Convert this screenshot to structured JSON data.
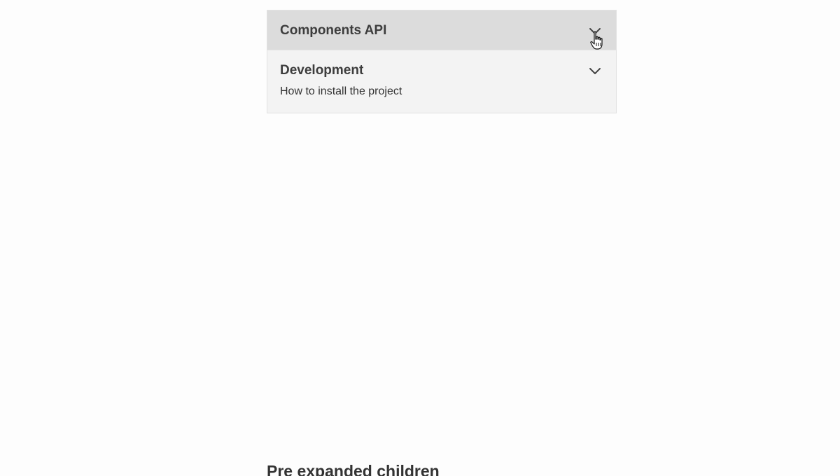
{
  "accordion": {
    "items": [
      {
        "title": "Components API",
        "subtitle": "",
        "state": "hovered",
        "icon": "chevron-down-icon"
      },
      {
        "title": "Development",
        "subtitle": "How to install the project",
        "state": "collapsed",
        "icon": "chevron-down-icon"
      }
    ]
  },
  "sections": {
    "pre_expanded_heading": "Pre expanded children"
  },
  "colors": {
    "hover_background": "#dcdcdc",
    "item_background": "#f3f3f3",
    "border": "#e2e2e2",
    "text": "#333333"
  }
}
